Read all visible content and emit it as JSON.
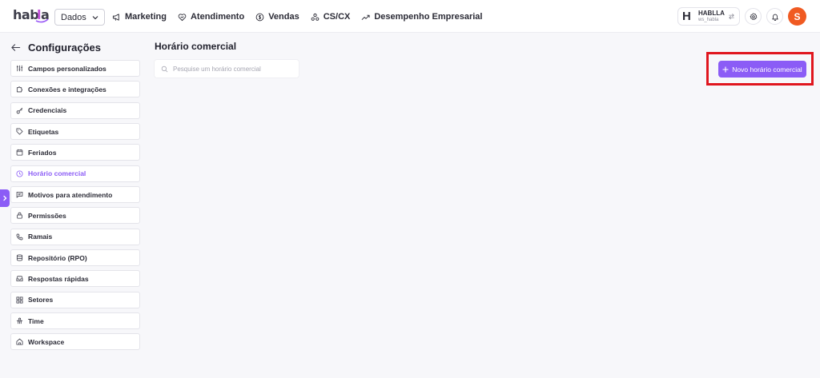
{
  "app": {
    "logo_text": "habla"
  },
  "topbar": {
    "module_select": "Dados",
    "nav": [
      {
        "label": "Marketing",
        "icon": "megaphone-icon"
      },
      {
        "label": "Atendimento",
        "icon": "heart-handshake-icon"
      },
      {
        "label": "Vendas",
        "icon": "dollar-circle-icon"
      },
      {
        "label": "CS/CX",
        "icon": "users-icon"
      },
      {
        "label": "Desempenho Empresarial",
        "icon": "trending-up-icon"
      }
    ],
    "workspace": {
      "letter": "H",
      "name": "HABLLA",
      "slug": "ws_habla"
    },
    "avatar_letter": "S"
  },
  "sidebar": {
    "title": "Configurações",
    "items": [
      {
        "label": "Campos personalizados",
        "icon": "sliders-icon"
      },
      {
        "label": "Conexões e integrações",
        "icon": "puzzle-icon"
      },
      {
        "label": "Credenciais",
        "icon": "key-icon"
      },
      {
        "label": "Etiquetas",
        "icon": "tag-icon"
      },
      {
        "label": "Feriados",
        "icon": "calendar-icon"
      },
      {
        "label": "Horário comercial",
        "icon": "clock-icon",
        "active": true
      },
      {
        "label": "Motivos para atendimento",
        "icon": "message-square-icon"
      },
      {
        "label": "Permissões",
        "icon": "lock-icon"
      },
      {
        "label": "Ramais",
        "icon": "phone-icon"
      },
      {
        "label": "Repositório (RPO)",
        "icon": "database-icon"
      },
      {
        "label": "Respostas rápidas",
        "icon": "inbox-icon"
      },
      {
        "label": "Setores",
        "icon": "grid-icon"
      },
      {
        "label": "Time",
        "icon": "team-icon"
      },
      {
        "label": "Workspace",
        "icon": "home-icon"
      }
    ]
  },
  "main": {
    "title": "Horário comercial",
    "search_placeholder": "Pesquise um horário comercial",
    "new_button_label": "Novo horário comercial"
  },
  "colors": {
    "accent": "#8b5cf6",
    "avatar": "#f05a22",
    "highlight": "#e0161e"
  }
}
